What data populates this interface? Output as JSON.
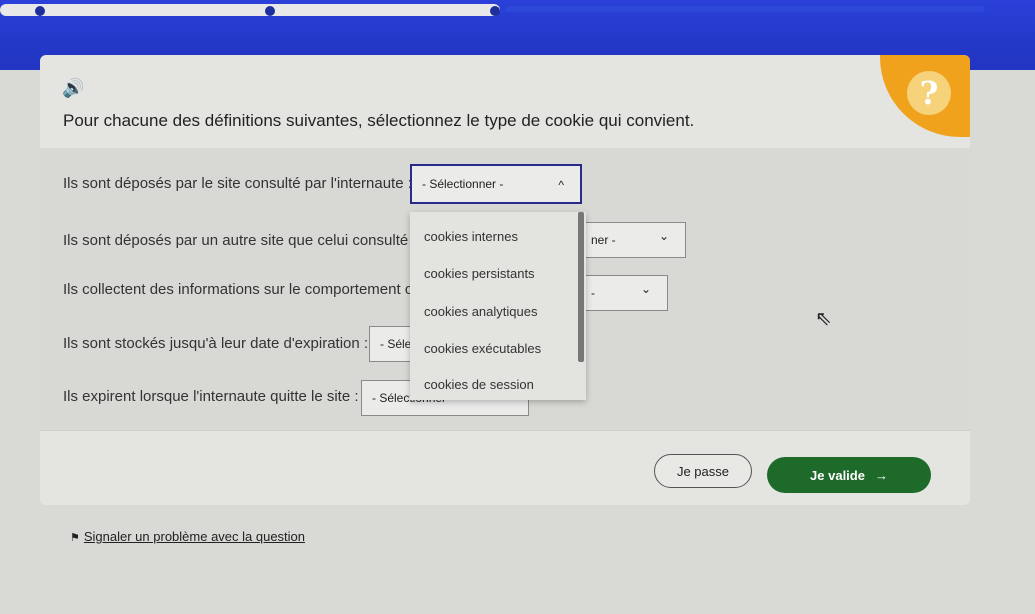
{
  "instruction": "Pour chacune des définitions suivantes, sélectionnez le type de cookie qui convient.",
  "help_symbol": "?",
  "questions": [
    {
      "text": "Ils sont déposés par le site consulté par l'internaute :",
      "select": "- Sélectionner -"
    },
    {
      "text": "Ils sont déposés par un autre site que celui consulté p",
      "select": "ner -"
    },
    {
      "text": "Ils collectent des informations sur le comportement c",
      "select": "-"
    },
    {
      "text": "Ils sont stockés jusqu'à leur date d'expiration :",
      "select": "- Séle"
    },
    {
      "text": "Ils expirent lorsque l'internaute quitte le site :",
      "select": "- Sélectionner"
    }
  ],
  "dropdown_options": [
    "cookies internes",
    "cookies persistants",
    "cookies analytiques",
    "cookies exécutables",
    "cookies de session"
  ],
  "buttons": {
    "pass": "Je passe",
    "validate": "Je valide",
    "validate_arrow": "→"
  },
  "report_link": "Signaler un problème avec la question",
  "icons": {
    "speaker": "🔊",
    "flag": "⚑",
    "chevron_up": "^",
    "chevron_down": "⌄"
  },
  "colors": {
    "banner": "#2438c9",
    "help_badge": "#f0a21d",
    "validate_button": "#1d6a2b"
  }
}
